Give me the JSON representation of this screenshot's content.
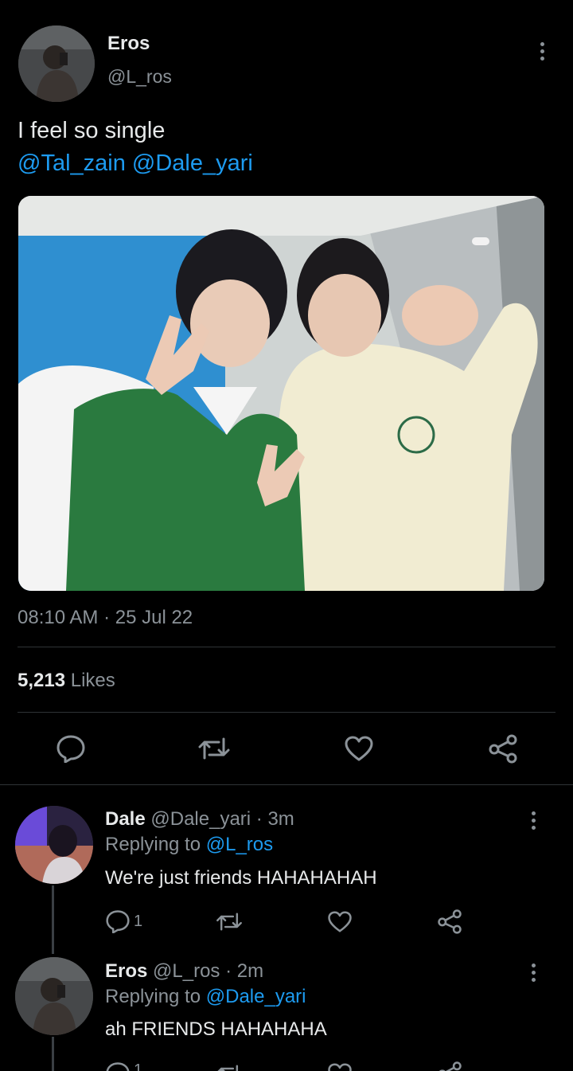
{
  "tweet": {
    "author_name": "Eros",
    "author_handle": "@L_ros",
    "text": "I feel so single",
    "mentions": "@Tal_zain @Dale_yari",
    "timestamp": "08:10 AM · 25 Jul 22",
    "likes_count": "5,213",
    "likes_label": "Likes"
  },
  "replies": [
    {
      "name": "Dale",
      "handle": "@Dale_yari",
      "time": "· 3m",
      "replying_prefix": "Replying to",
      "replying_to": "@L_ros",
      "text": "We're just friends HAHAHAHAH",
      "reply_count": "1"
    },
    {
      "name": "Eros",
      "handle": "@L_ros",
      "time": "· 2m",
      "replying_prefix": "Replying to",
      "replying_to": "@Dale_yari",
      "text": "ah FRIENDS HAHAHAHA",
      "reply_count": "1"
    }
  ],
  "icons": {
    "reply": "reply-icon",
    "retweet": "retweet-icon",
    "like": "heart-icon",
    "share": "share-icon",
    "more": "more-icon"
  },
  "colors": {
    "background": "#000000",
    "accent": "#1d9bf0",
    "muted": "#8b9298",
    "divider": "#2f3336"
  }
}
